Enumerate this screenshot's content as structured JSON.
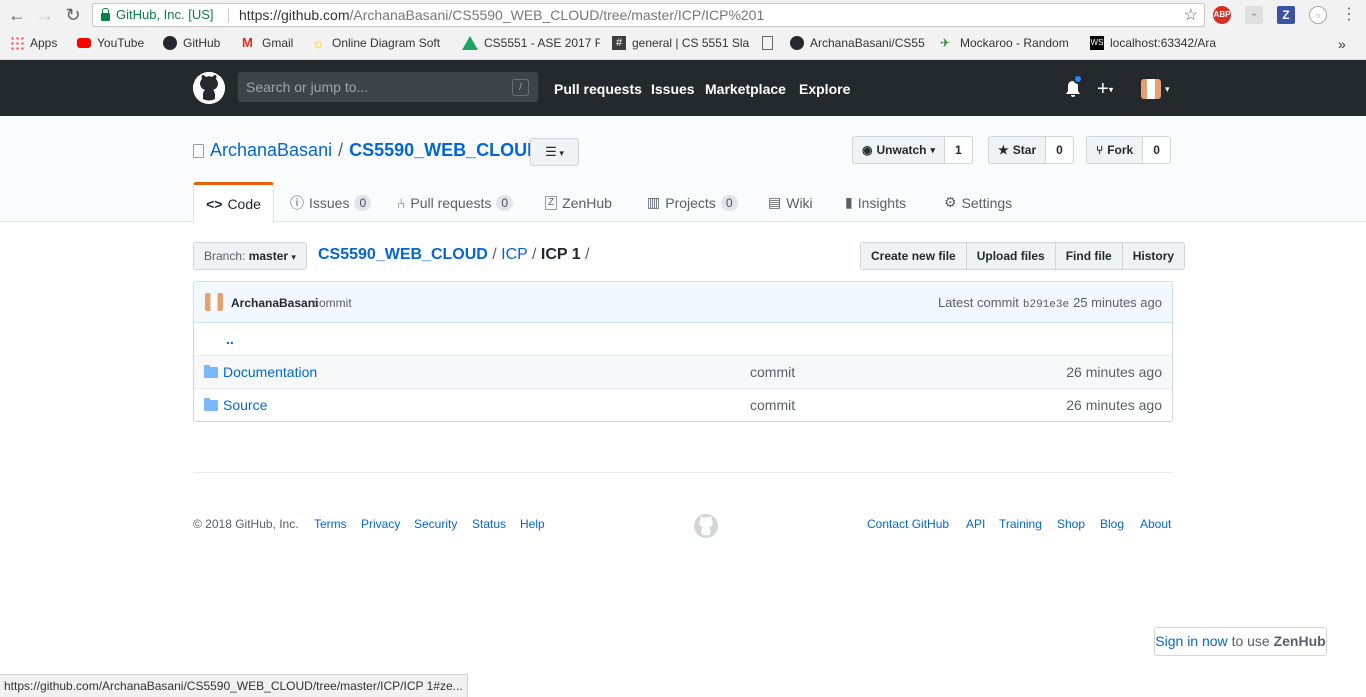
{
  "browser": {
    "secure_label": "GitHub, Inc. [US]",
    "url_host": "https://github.com",
    "url_path": "/ArchanaBasani/CS5590_WEB_CLOUD/tree/master/ICP/ICP%201",
    "ext_abp": "ABP",
    "ext_z": "Z",
    "bookmarks": [
      {
        "label": "Apps"
      },
      {
        "label": "YouTube"
      },
      {
        "label": "GitHub"
      },
      {
        "label": "Gmail"
      },
      {
        "label": "Online Diagram Soft"
      },
      {
        "label": "CS5551 - ASE 2017 F"
      },
      {
        "label": "general | CS 5551 Sla"
      },
      {
        "label": ""
      },
      {
        "label": "ArchanaBasani/CS55"
      },
      {
        "label": "Mockaroo - Random"
      },
      {
        "label": "localhost:63342/Ara"
      }
    ],
    "more_bookmarks": "»"
  },
  "header": {
    "search_placeholder": "Search or jump to...",
    "search_key": "/",
    "nav": [
      "Pull requests",
      "Issues",
      "Marketplace",
      "Explore"
    ]
  },
  "repo": {
    "owner": "ArchanaBasani",
    "separator": "/",
    "name": "CS5590_WEB_CLOUD",
    "watch": {
      "label": "Unwatch",
      "count": "1"
    },
    "star": {
      "label": "Star",
      "count": "0"
    },
    "fork": {
      "label": "Fork",
      "count": "0"
    },
    "tabs": [
      {
        "label": "Code",
        "count": ""
      },
      {
        "label": "Issues",
        "count": "0"
      },
      {
        "label": "Pull requests",
        "count": "0"
      },
      {
        "label": "ZenHub",
        "count": ""
      },
      {
        "label": "Projects",
        "count": "0"
      },
      {
        "label": "Wiki",
        "count": ""
      },
      {
        "label": "Insights",
        "count": ""
      },
      {
        "label": "Settings",
        "count": ""
      }
    ]
  },
  "filenav": {
    "branch_prefix": "Branch:",
    "branch": "master",
    "crumbs": [
      "CS5590_WEB_CLOUD",
      "ICP"
    ],
    "current": "ICP 1",
    "actions": [
      "Create new file",
      "Upload files",
      "Find file",
      "History"
    ]
  },
  "commit": {
    "author": "ArchanaBasani",
    "message": "commit",
    "latest_label": "Latest commit",
    "sha": "b291e3e",
    "age": "25 minutes ago"
  },
  "files": {
    "parent": "..",
    "rows": [
      {
        "name": "Documentation",
        "message": "commit",
        "age": "26 minutes ago"
      },
      {
        "name": "Source",
        "message": "commit",
        "age": "26 minutes ago"
      }
    ]
  },
  "footer": {
    "copyright": "© 2018 GitHub, Inc.",
    "left_links": [
      "Terms",
      "Privacy",
      "Security",
      "Status",
      "Help"
    ],
    "right_links": [
      "Contact GitHub",
      "API",
      "Training",
      "Shop",
      "Blog",
      "About"
    ]
  },
  "zenhub": {
    "sign_in": "Sign in now",
    "suffix": "to use",
    "brand": "ZenHub"
  },
  "status_url": "https://github.com/ArchanaBasani/CS5590_WEB_CLOUD/tree/master/ICP/ICP 1#ze..."
}
